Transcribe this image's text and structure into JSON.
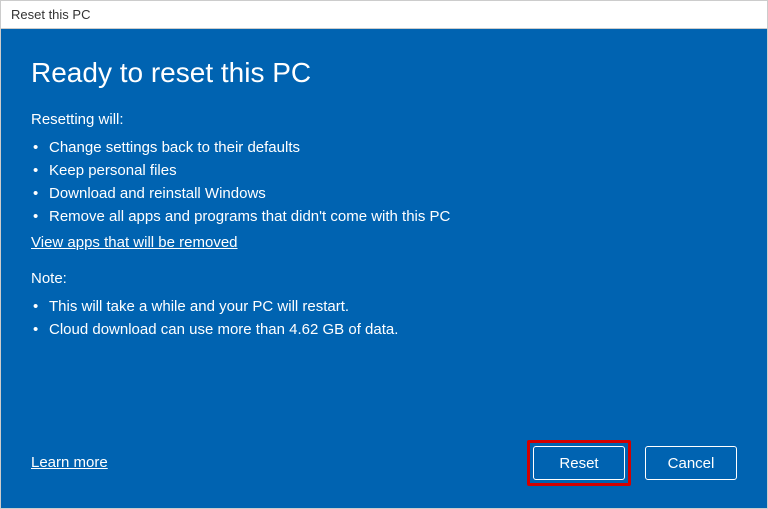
{
  "window": {
    "title": "Reset this PC"
  },
  "heading": "Ready to reset this PC",
  "resetting": {
    "label": "Resetting will:",
    "items": [
      "Change settings back to their defaults",
      "Keep personal files",
      "Download and reinstall Windows",
      "Remove all apps and programs that didn't come with this PC"
    ]
  },
  "view_apps_link": "View apps that will be removed",
  "note": {
    "label": "Note:",
    "items": [
      "This will take a while and your PC will restart.",
      "Cloud download can use more than 4.62 GB of data."
    ]
  },
  "learn_more_link": "Learn more",
  "buttons": {
    "reset": "Reset",
    "cancel": "Cancel"
  }
}
